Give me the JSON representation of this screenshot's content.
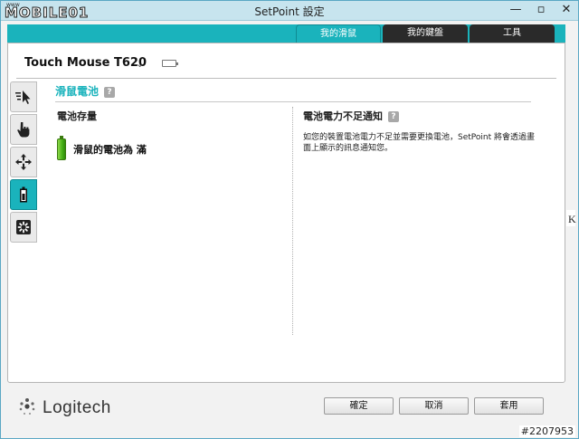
{
  "watermark": {
    "brand": "MOBILE01",
    "brand_small": "www",
    "id": "#2207953"
  },
  "window": {
    "title": "SetPoint 設定",
    "controls": [
      "—",
      "▫",
      "✕"
    ]
  },
  "tabs": [
    {
      "label": "我的滑鼠",
      "active": true
    },
    {
      "label": "我的鍵盤",
      "active": false
    },
    {
      "label": "工具",
      "active": false
    }
  ],
  "device": {
    "name": "Touch Mouse T620"
  },
  "sidenav": [
    {
      "icon": "pointer-speed-icon",
      "active": false
    },
    {
      "icon": "touch-hand-icon",
      "active": false
    },
    {
      "icon": "move-arrows-icon",
      "active": false
    },
    {
      "icon": "battery-icon",
      "active": true
    },
    {
      "icon": "settings-gear-icon",
      "active": false
    }
  ],
  "section": {
    "title": "滑鼠電池",
    "help": "?"
  },
  "left": {
    "title": "電池存量",
    "status": "滑鼠的電池為 滿"
  },
  "right": {
    "title": "電池電力不足通知",
    "help": "?",
    "description": "如您的裝置電池電力不足並需要更換電池，SetPoint 將會透過畫面上顯示的訊息通知您。"
  },
  "footer": {
    "logo": "Logitech",
    "ok_label": "確定",
    "cancel_label": "取消",
    "apply_label": "套用"
  },
  "edge": {
    "letter": "K"
  },
  "colors": {
    "accent": "#1ab3bc",
    "tab_inactive": "#2a2a2a",
    "battery_green": "#46b016"
  }
}
